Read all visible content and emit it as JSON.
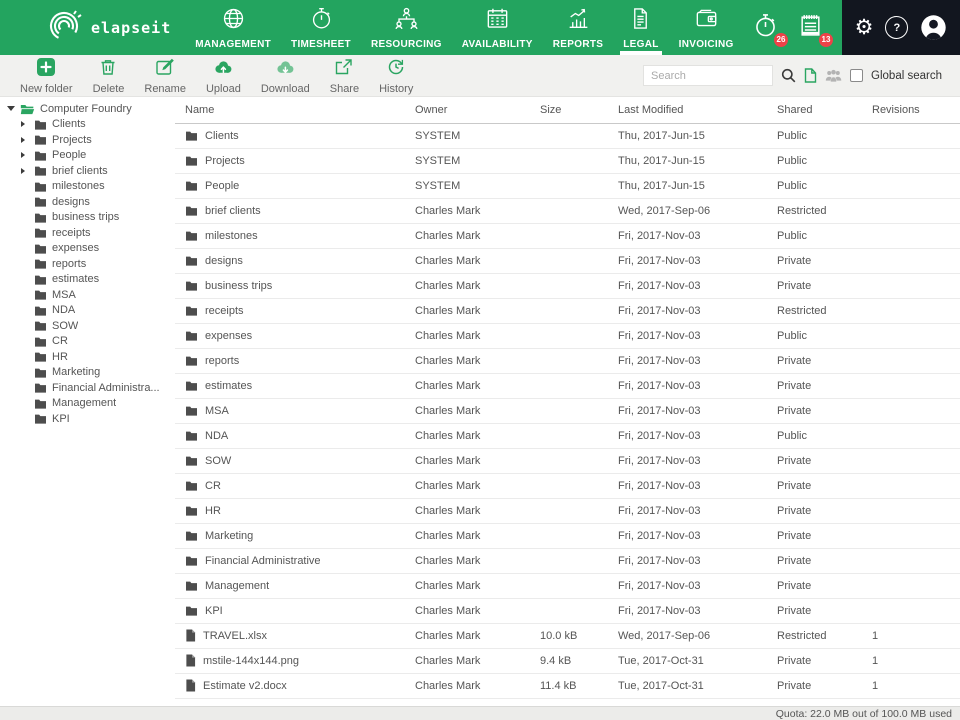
{
  "brand": {
    "name": "elapseit",
    "logo_icon": "elapseit-arcs-logo"
  },
  "nav": {
    "active": "LEGAL",
    "items": [
      {
        "label": "MANAGEMENT",
        "icon": "globe-icon"
      },
      {
        "label": "TIMESHEET",
        "icon": "stopwatch-icon"
      },
      {
        "label": "RESOURCING",
        "icon": "org-chart-icon"
      },
      {
        "label": "AVAILABILITY",
        "icon": "calendar-icon"
      },
      {
        "label": "REPORTS",
        "icon": "bar-chart-icon"
      },
      {
        "label": "LEGAL",
        "icon": "document-icon"
      },
      {
        "label": "INVOICING",
        "icon": "wallet-icon"
      }
    ]
  },
  "notifications": {
    "timer_badge": "26",
    "invoicing_badge": "13",
    "timer_icon": "stopwatch-icon",
    "invoicing_icon": "notepad-icon"
  },
  "account": {
    "help_glyph": "?",
    "gear_glyph": "⚙"
  },
  "toolbar": {
    "buttons": [
      {
        "label": "New folder",
        "icon": "new-folder-icon"
      },
      {
        "label": "Delete",
        "icon": "trash-icon"
      },
      {
        "label": "Rename",
        "icon": "rename-pencil-icon"
      },
      {
        "label": "Upload",
        "icon": "cloud-upload-icon"
      },
      {
        "label": "Download",
        "icon": "cloud-download-icon"
      },
      {
        "label": "Share",
        "icon": "share-icon"
      },
      {
        "label": "History",
        "icon": "history-icon"
      }
    ]
  },
  "search": {
    "placeholder": "Search",
    "global_label": "Global search"
  },
  "sidebar": {
    "root": "Computer Foundry",
    "items": [
      {
        "label": "Clients",
        "expandable": true
      },
      {
        "label": "Projects",
        "expandable": true
      },
      {
        "label": "People",
        "expandable": true
      },
      {
        "label": "brief clients",
        "expandable": true
      },
      {
        "label": "milestones",
        "expandable": false
      },
      {
        "label": "designs",
        "expandable": false
      },
      {
        "label": "business trips",
        "expandable": false
      },
      {
        "label": "receipts",
        "expandable": false
      },
      {
        "label": "expenses",
        "expandable": false
      },
      {
        "label": "reports",
        "expandable": false
      },
      {
        "label": "estimates",
        "expandable": false
      },
      {
        "label": "MSA",
        "expandable": false
      },
      {
        "label": "NDA",
        "expandable": false
      },
      {
        "label": "SOW",
        "expandable": false
      },
      {
        "label": "CR",
        "expandable": false
      },
      {
        "label": "HR",
        "expandable": false
      },
      {
        "label": "Marketing",
        "expandable": false
      },
      {
        "label": "Financial Administra...",
        "expandable": false
      },
      {
        "label": "Management",
        "expandable": false
      },
      {
        "label": "KPI",
        "expandable": false
      }
    ]
  },
  "table": {
    "columns": [
      "Name",
      "Owner",
      "Size",
      "Last Modified",
      "Shared",
      "Revisions"
    ],
    "rows": [
      {
        "name": "Clients",
        "type": "folder",
        "owner": "SYSTEM",
        "size": "",
        "modified": "Thu, 2017-Jun-15",
        "shared": "Public",
        "revisions": ""
      },
      {
        "name": "Projects",
        "type": "folder",
        "owner": "SYSTEM",
        "size": "",
        "modified": "Thu, 2017-Jun-15",
        "shared": "Public",
        "revisions": ""
      },
      {
        "name": "People",
        "type": "folder",
        "owner": "SYSTEM",
        "size": "",
        "modified": "Thu, 2017-Jun-15",
        "shared": "Public",
        "revisions": ""
      },
      {
        "name": "brief clients",
        "type": "folder",
        "owner": "Charles Mark",
        "size": "",
        "modified": "Wed, 2017-Sep-06",
        "shared": "Restricted",
        "revisions": ""
      },
      {
        "name": "milestones",
        "type": "folder",
        "owner": "Charles Mark",
        "size": "",
        "modified": "Fri, 2017-Nov-03",
        "shared": "Public",
        "revisions": ""
      },
      {
        "name": "designs",
        "type": "folder",
        "owner": "Charles Mark",
        "size": "",
        "modified": "Fri, 2017-Nov-03",
        "shared": "Private",
        "revisions": ""
      },
      {
        "name": "business trips",
        "type": "folder",
        "owner": "Charles Mark",
        "size": "",
        "modified": "Fri, 2017-Nov-03",
        "shared": "Private",
        "revisions": ""
      },
      {
        "name": "receipts",
        "type": "folder",
        "owner": "Charles Mark",
        "size": "",
        "modified": "Fri, 2017-Nov-03",
        "shared": "Restricted",
        "revisions": ""
      },
      {
        "name": "expenses",
        "type": "folder",
        "owner": "Charles Mark",
        "size": "",
        "modified": "Fri, 2017-Nov-03",
        "shared": "Public",
        "revisions": ""
      },
      {
        "name": "reports",
        "type": "folder",
        "owner": "Charles Mark",
        "size": "",
        "modified": "Fri, 2017-Nov-03",
        "shared": "Private",
        "revisions": ""
      },
      {
        "name": "estimates",
        "type": "folder",
        "owner": "Charles Mark",
        "size": "",
        "modified": "Fri, 2017-Nov-03",
        "shared": "Private",
        "revisions": ""
      },
      {
        "name": "MSA",
        "type": "folder",
        "owner": "Charles Mark",
        "size": "",
        "modified": "Fri, 2017-Nov-03",
        "shared": "Private",
        "revisions": ""
      },
      {
        "name": "NDA",
        "type": "folder",
        "owner": "Charles Mark",
        "size": "",
        "modified": "Fri, 2017-Nov-03",
        "shared": "Public",
        "revisions": ""
      },
      {
        "name": "SOW",
        "type": "folder",
        "owner": "Charles Mark",
        "size": "",
        "modified": "Fri, 2017-Nov-03",
        "shared": "Private",
        "revisions": ""
      },
      {
        "name": "CR",
        "type": "folder",
        "owner": "Charles Mark",
        "size": "",
        "modified": "Fri, 2017-Nov-03",
        "shared": "Private",
        "revisions": ""
      },
      {
        "name": "HR",
        "type": "folder",
        "owner": "Charles Mark",
        "size": "",
        "modified": "Fri, 2017-Nov-03",
        "shared": "Private",
        "revisions": ""
      },
      {
        "name": "Marketing",
        "type": "folder",
        "owner": "Charles Mark",
        "size": "",
        "modified": "Fri, 2017-Nov-03",
        "shared": "Private",
        "revisions": ""
      },
      {
        "name": "Financial Administrative",
        "type": "folder",
        "owner": "Charles Mark",
        "size": "",
        "modified": "Fri, 2017-Nov-03",
        "shared": "Private",
        "revisions": ""
      },
      {
        "name": "Management",
        "type": "folder",
        "owner": "Charles Mark",
        "size": "",
        "modified": "Fri, 2017-Nov-03",
        "shared": "Private",
        "revisions": ""
      },
      {
        "name": "KPI",
        "type": "folder",
        "owner": "Charles Mark",
        "size": "",
        "modified": "Fri, 2017-Nov-03",
        "shared": "Private",
        "revisions": ""
      },
      {
        "name": "TRAVEL.xlsx",
        "type": "file",
        "owner": "Charles Mark",
        "size": "10.0 kB",
        "modified": "Wed, 2017-Sep-06",
        "shared": "Restricted",
        "revisions": "1"
      },
      {
        "name": "mstile-144x144.png",
        "type": "file",
        "owner": "Charles Mark",
        "size": "9.4 kB",
        "modified": "Tue, 2017-Oct-31",
        "shared": "Private",
        "revisions": "1"
      },
      {
        "name": "Estimate v2.docx",
        "type": "file",
        "owner": "Charles Mark",
        "size": "11.4 kB",
        "modified": "Tue, 2017-Oct-31",
        "shared": "Private",
        "revisions": "1"
      }
    ]
  },
  "footer": {
    "quota": "Quota: 22.0 MB out of 100.0 MB used"
  },
  "colors": {
    "header_green": "#23a45f",
    "icon_green": "#2aa561",
    "download_green": "#74c395",
    "dark_panel": "#12161f",
    "badge_red": "#ee4248"
  }
}
